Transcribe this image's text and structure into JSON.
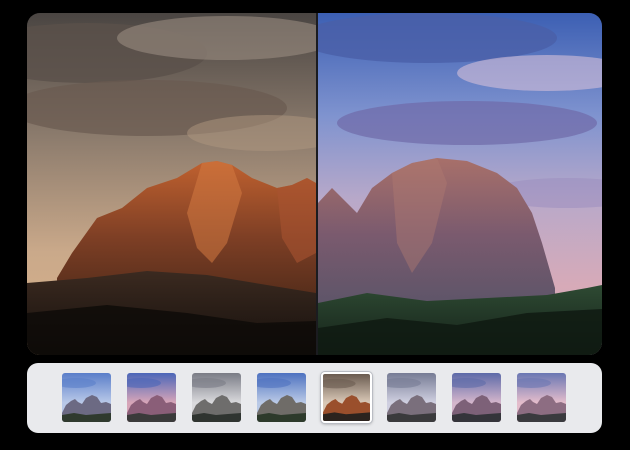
{
  "editor": {
    "before_tone": "warm-sepia",
    "after_tone": "vivid-dusk"
  },
  "filters": [
    {
      "id": "vivid-blue",
      "sky": "#5a7ec9",
      "sky2": "#b8c8e8",
      "rock": "#6c6a83",
      "ground": "#2f3a2e",
      "selected": false
    },
    {
      "id": "rose-dusk",
      "sky": "#4b66b8",
      "sky2": "#d6a5b8",
      "rock": "#8a5e78",
      "ground": "#3a3a3a",
      "selected": false
    },
    {
      "id": "mono-fade",
      "sky": "#7a7c86",
      "sky2": "#d9d9dc",
      "rock": "#6e6d6c",
      "ground": "#2f3430",
      "selected": false
    },
    {
      "id": "cool-clear",
      "sky": "#4e72c0",
      "sky2": "#b9c9e6",
      "rock": "#6f6c68",
      "ground": "#2d3a2b",
      "selected": false
    },
    {
      "id": "warm-sepia",
      "sky": "#6a5b50",
      "sky2": "#d8c7b6",
      "rock": "#9a4f2c",
      "ground": "#2b231e",
      "selected": true
    },
    {
      "id": "soft-matte",
      "sky": "#777c95",
      "sky2": "#cfcfe0",
      "rock": "#7a6f7c",
      "ground": "#3a3a3c",
      "selected": false
    },
    {
      "id": "lilac-haze",
      "sky": "#5d6aa8",
      "sky2": "#d3b5cb",
      "rock": "#7d6178",
      "ground": "#34343a",
      "selected": false
    },
    {
      "id": "pastel-pink",
      "sky": "#6a77b3",
      "sky2": "#e3bccb",
      "rock": "#8d6d82",
      "ground": "#3a3a3e",
      "selected": false
    }
  ],
  "colors": {
    "background": "#000000",
    "filter_bar": "#e9eaed",
    "divider": "#1b1c20",
    "selected_ring": "#ffffff"
  }
}
